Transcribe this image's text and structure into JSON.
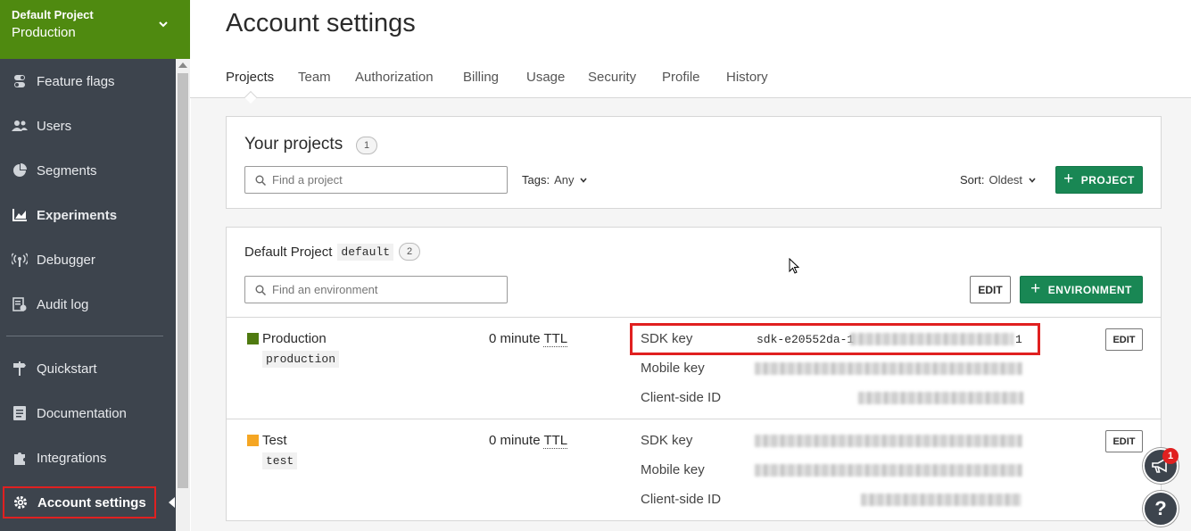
{
  "sidebar": {
    "project_name": "Default Project",
    "environment": "Production",
    "items": [
      {
        "label": "Feature flags",
        "icon": "toggle-icon"
      },
      {
        "label": "Users",
        "icon": "users-icon"
      },
      {
        "label": "Segments",
        "icon": "pie-icon"
      },
      {
        "label": "Experiments",
        "icon": "chart-icon"
      },
      {
        "label": "Debugger",
        "icon": "broadcast-icon"
      },
      {
        "label": "Audit log",
        "icon": "log-icon"
      },
      {
        "label": "Quickstart",
        "icon": "signpost-icon"
      },
      {
        "label": "Documentation",
        "icon": "doc-icon"
      },
      {
        "label": "Integrations",
        "icon": "puzzle-icon"
      }
    ],
    "account_settings": "Account settings"
  },
  "header": {
    "title": "Account settings",
    "tabs": [
      "Projects",
      "Team",
      "Authorization",
      "Billing",
      "Usage",
      "Security",
      "Profile",
      "History"
    ]
  },
  "projects_card": {
    "title": "Your projects",
    "count": "1",
    "search_placeholder": "Find a project",
    "tags_label": "Tags:",
    "tags_value": "Any",
    "sort_label": "Sort:",
    "sort_value": "Oldest",
    "add_button": "PROJECT"
  },
  "project": {
    "name": "Default Project",
    "key": "default",
    "env_count": "2",
    "search_placeholder": "Find an environment",
    "edit_button": "EDIT",
    "add_env_button": "ENVIRONMENT",
    "environments": [
      {
        "name": "Production",
        "key": "production",
        "color": "#4f7a10",
        "ttl_prefix": "0 minute",
        "ttl_unit": "TTL",
        "sdk_label": "SDK key",
        "sdk_visible": "sdk-e20552da-1",
        "sdk_tail": "1",
        "mobile_label": "Mobile key",
        "client_label": "Client-side ID",
        "edit": "EDIT"
      },
      {
        "name": "Test",
        "key": "test",
        "color": "#f5a623",
        "ttl_prefix": "0 minute",
        "ttl_unit": "TTL",
        "sdk_label": "SDK key",
        "mobile_label": "Mobile key",
        "client_label": "Client-side ID",
        "edit": "EDIT"
      }
    ]
  },
  "fab": {
    "notification_count": "1",
    "help": "?"
  }
}
